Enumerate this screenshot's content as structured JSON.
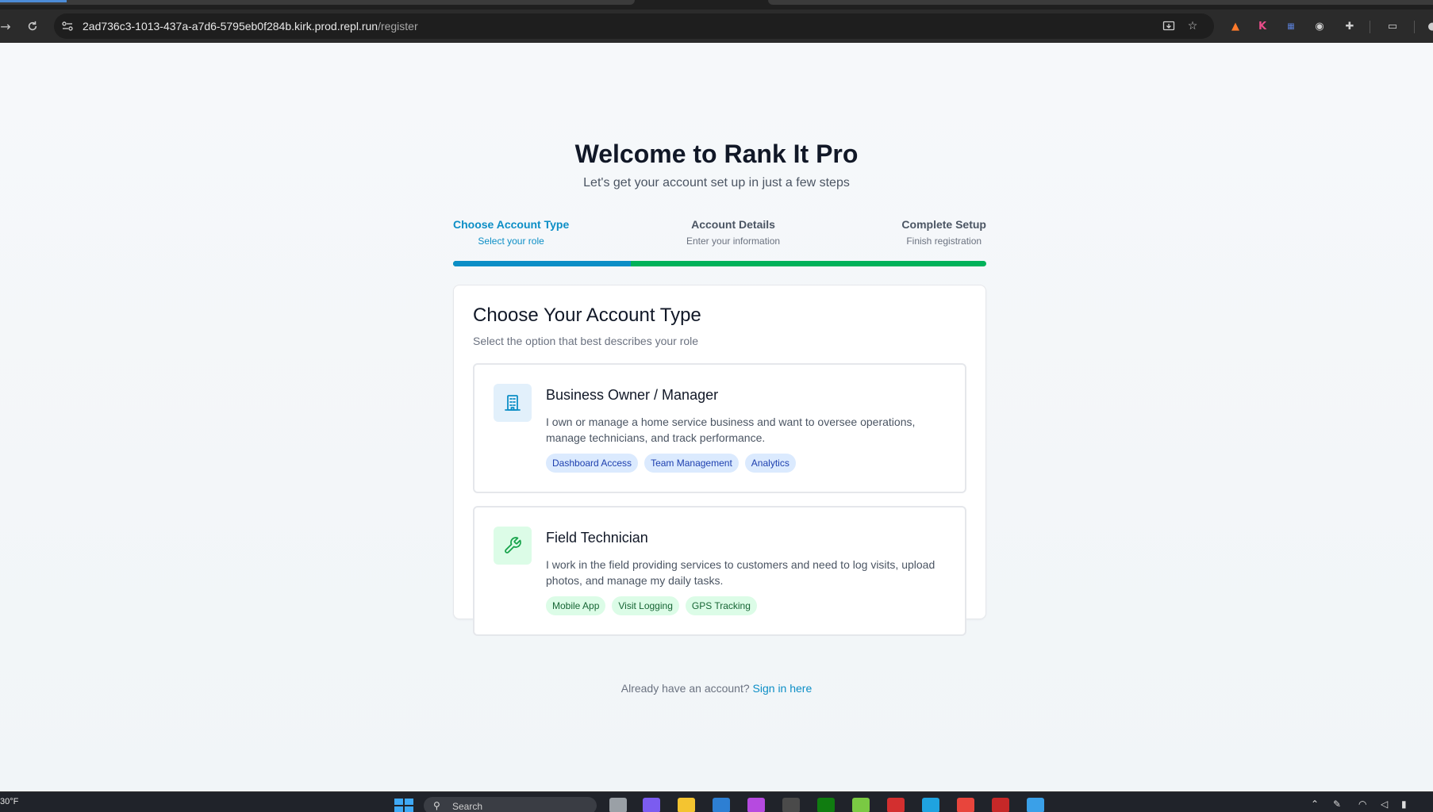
{
  "browser": {
    "url_host": "2ad736c3-1013-437a-a7d6-5795eb0f284b.kirk.prod.repl.run",
    "url_path": "/register",
    "extension_label": "K"
  },
  "header": {
    "title": "Welcome to Rank It Pro",
    "subtitle": "Let's get your account set up in just a few steps"
  },
  "steps": [
    {
      "title": "Choose Account Type",
      "subtitle": "Select your role",
      "active": true
    },
    {
      "title": "Account Details",
      "subtitle": "Enter your information",
      "active": false
    },
    {
      "title": "Complete Setup",
      "subtitle": "Finish registration",
      "active": false
    }
  ],
  "progress": {
    "completed_fraction": 0.333,
    "active_color": "#0c8ec6",
    "rest_color": "#00b25a"
  },
  "card": {
    "title": "Choose Your Account Type",
    "subtitle": "Select the option that best describes your role",
    "options": [
      {
        "icon": "building-icon",
        "title": "Business Owner / Manager",
        "description": "I own or manage a home service business and want to oversee operations, manage technicians, and track performance.",
        "tags": [
          "Dashboard Access",
          "Team Management",
          "Analytics"
        ]
      },
      {
        "icon": "wrench-icon",
        "title": "Field Technician",
        "description": "I work in the field providing services to customers and need to log visits, upload photos, and manage my daily tasks.",
        "tags": [
          "Mobile App",
          "Visit Logging",
          "GPS Tracking"
        ]
      }
    ]
  },
  "footer": {
    "prompt": "Already have an account?",
    "link": "Sign in here"
  },
  "taskbar": {
    "weather": "30°F",
    "search_placeholder": "Search"
  }
}
